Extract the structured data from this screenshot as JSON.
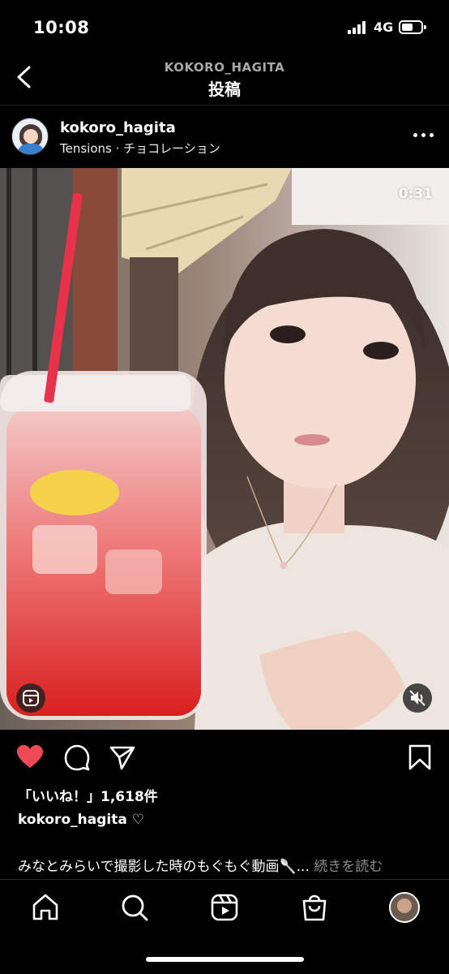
{
  "status_bar": {
    "time": "10:08",
    "network": "4G",
    "battery_level": 0.6
  },
  "header": {
    "account": "KOKORO_HAGITA",
    "title": "投稿"
  },
  "post": {
    "username": "kokoro_hagita",
    "audio": "Tensions · チョコレーション",
    "video_duration": "0:31",
    "likes": "「いいね！」1,618件",
    "caption_user": "kokoro_hagita ♡",
    "caption_text": "みなとみらいで撮影した時のもぐもぐ動画🥄...",
    "caption_more": "続きを読む",
    "liked": true
  },
  "colors": {
    "like_red": "#ed4956",
    "background": "#000000",
    "muted_text": "#8e8e8e"
  },
  "icons": {
    "actions": [
      "heart-icon",
      "comment-icon",
      "share-icon",
      "bookmark-icon"
    ],
    "tabs": [
      "home-icon",
      "search-icon",
      "reels-icon",
      "shop-icon",
      "profile-avatar"
    ]
  }
}
